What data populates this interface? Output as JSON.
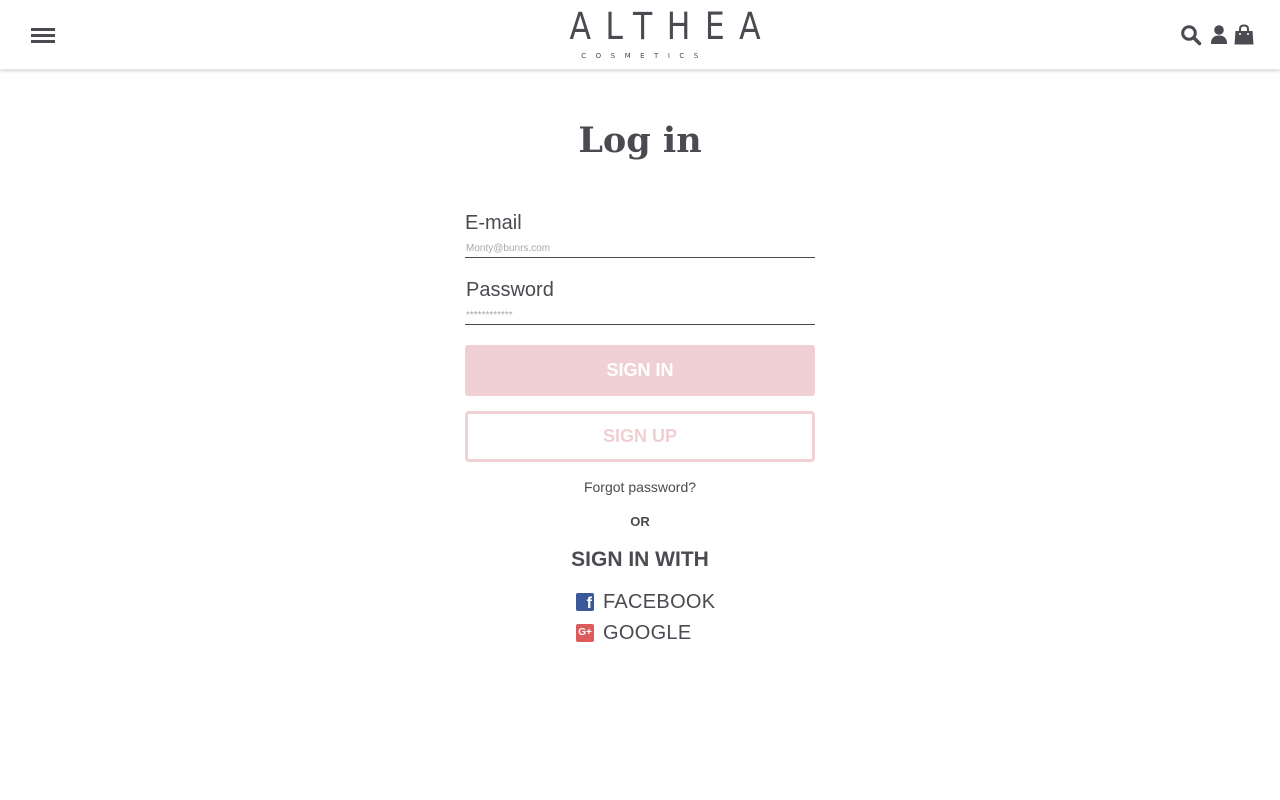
{
  "header": {
    "logo_main": "ALTHEA",
    "logo_sub": "COSMETICS",
    "icons": [
      "menu-icon",
      "search-icon",
      "user-icon",
      "shopping-bag-icon"
    ]
  },
  "page": {
    "title": "Log in"
  },
  "form": {
    "email_label": "E-mail",
    "email_placeholder": "Monty@bunrs.com",
    "password_label": "Password",
    "password_placeholder": "************",
    "signin_label": "SIGN IN",
    "signup_label": "SIGN UP",
    "forgot_label": "Forgot password?"
  },
  "social": {
    "or_label": "OR",
    "heading": "SIGN IN WITH",
    "facebook_label": "FACEBOOK",
    "google_label": "GOOGLE",
    "facebook_icon_glyph": "f",
    "google_icon_glyph": "G+"
  },
  "colors": {
    "text": "#4a4b50",
    "accent_pink": "#f0d0d4",
    "facebook_blue": "#3b5998",
    "google_red": "#dd5b5b"
  }
}
